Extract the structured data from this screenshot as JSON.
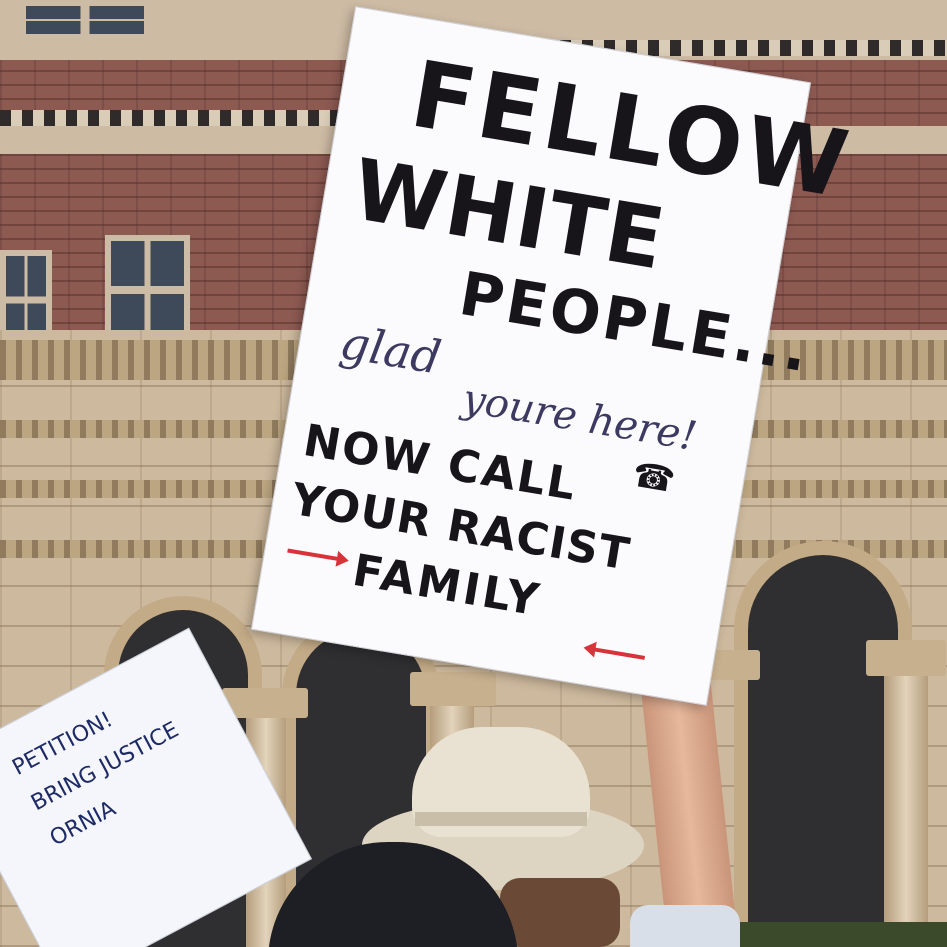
{
  "sign": {
    "line1": "FELLOW",
    "line2": "WHITE",
    "line3": "PEOPLE...",
    "script1": "glad",
    "script2": "youre here!",
    "line4": "NOW CALL",
    "line5": "YOUR RACIST",
    "line6": "FAMILY"
  },
  "background_sign": {
    "line1": "PETITION!",
    "line2": "BRING JUSTICE",
    "line3": "ORNIA"
  },
  "colors": {
    "marker_black": "#17141a",
    "script_ink": "#3d3a62",
    "arrow_red": "#d8323a",
    "brick": "#8d5a52",
    "stone": "#cdb99d"
  },
  "icons": [
    "phone-icon",
    "arrow-right-icon",
    "arrow-left-icon"
  ]
}
